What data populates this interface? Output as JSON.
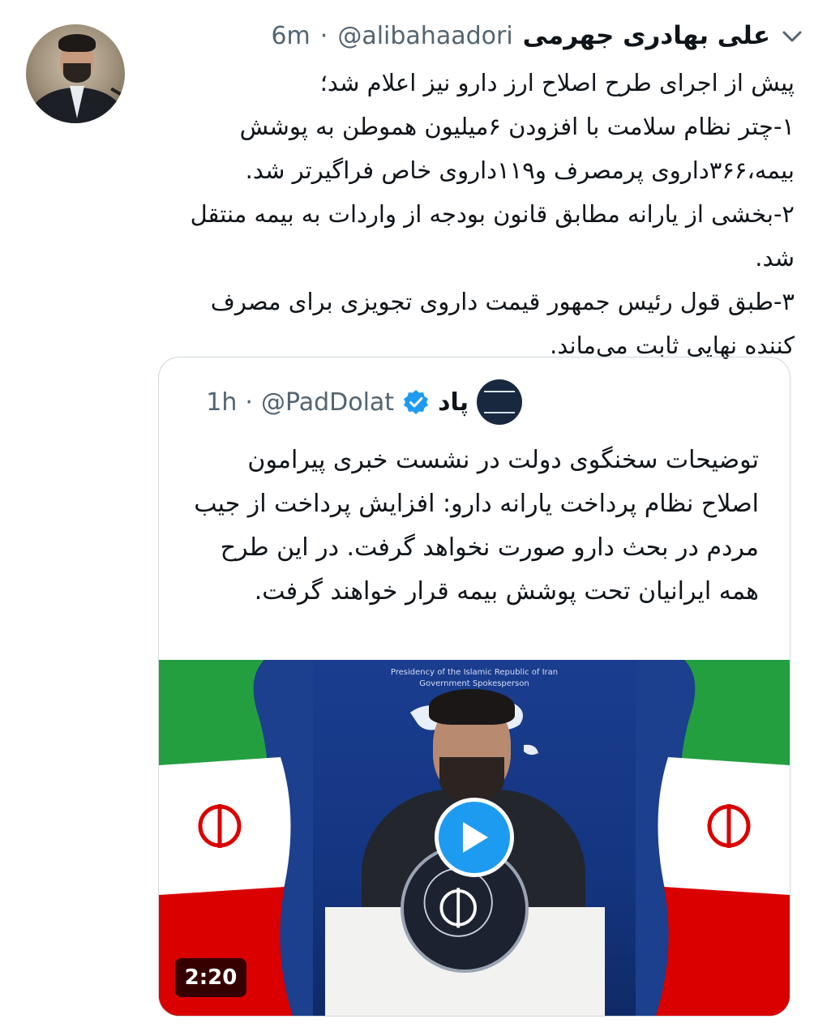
{
  "tweet": {
    "author_name": "علی بهادری جهرمی",
    "handle": "@alibahaadori",
    "separator": "·",
    "time": "6m",
    "lines": [
      "پیش از اجرای طرح اصلاح ارز دارو نیز اعلام شد؛",
      "۱-چتر نظام سلامت با افزودن ۶میلیون هموطن به پوشش بیمه،۳۶۶داروی پرمصرف و۱۱۹داروی خاص فراگیرتر شد.",
      "۲-بخشی از یارانه مطابق قانون بودجه از واردات به بیمه منتقل شد.",
      "۳-طبق قول رئیس جمهور قیمت داروی تجویزی برای مصرف کننده نهایی ثابت می‌ماند."
    ]
  },
  "quoted": {
    "author_name": "پاد",
    "handle": "@PadDolat",
    "separator": "·",
    "time": "1h",
    "text": "توضیحات سخنگوی دولت در نشست خبری پیرامون اصلاح نظام پرداخت یارانه دارو: افزایش پرداخت از جیب مردم در بحث دارو صورت نخواهد گرفت. در این طرح همه ایرانیان تحت پوشش بیمه قرار خواهند گرفت.",
    "video": {
      "backdrop_line1": "Presidency of the Islamic Republic of Iran",
      "backdrop_line2": "Government Spokesperson",
      "duration": "2:20"
    }
  },
  "icons": {
    "menu": "chevron-down-icon",
    "verified": "verified-badge-icon",
    "play": "play-icon"
  },
  "colors": {
    "accent": "#1d9bf0",
    "text": "#0f1419",
    "secondary_text": "#536471",
    "border": "#cfd9de"
  }
}
